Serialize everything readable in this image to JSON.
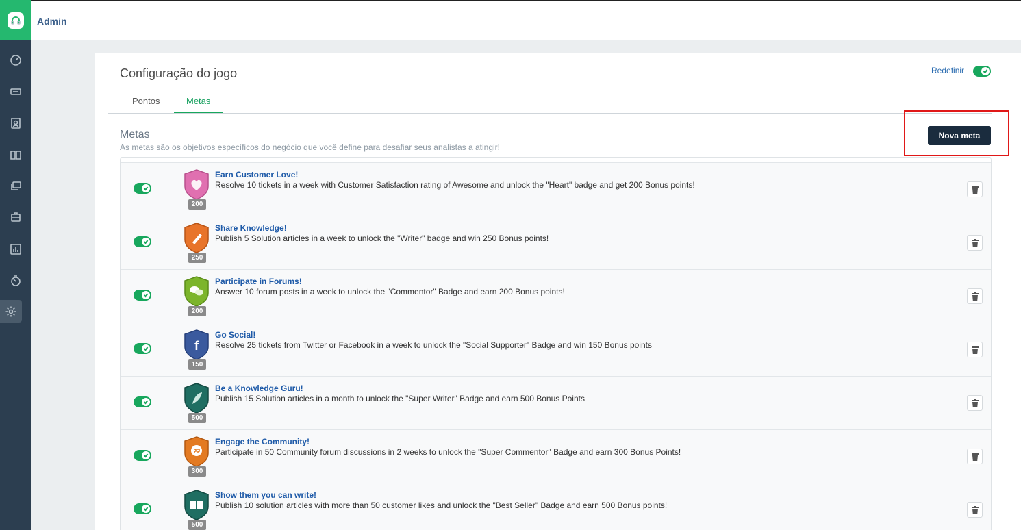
{
  "header": {
    "title": "Admin"
  },
  "sidebar": {
    "items": [
      {
        "icon": "dashboard-icon"
      },
      {
        "icon": "ticket-icon"
      },
      {
        "icon": "contacts-icon"
      },
      {
        "icon": "knowledge-base-icon"
      },
      {
        "icon": "forums-icon"
      },
      {
        "icon": "solutions-icon"
      },
      {
        "icon": "reports-icon"
      },
      {
        "icon": "timer-icon"
      },
      {
        "icon": "admin-gear-icon",
        "active": true
      }
    ]
  },
  "page": {
    "title": "Configuração do jogo",
    "reset_label": "Redefinir",
    "reset_enabled": true,
    "tabs": [
      {
        "label": "Pontos",
        "active": false
      },
      {
        "label": "Metas",
        "active": true
      }
    ],
    "section_title": "Metas",
    "section_desc": "As metas são os objetivos específicos do negócio que você define para desafiar seus analistas a atingir!",
    "new_goal_label": "Nova meta"
  },
  "goals": [
    {
      "name": "Earn Customer Love!",
      "desc": "Resolve 10 tickets in a week with Customer Satisfaction rating of Awesome and unlock the \"Heart\" badge and get 200 Bonus points!",
      "points": "200",
      "badge_color": "#e070b0",
      "badge_icon": "heart-badge-icon",
      "enabled": true
    },
    {
      "name": "Share Knowledge!",
      "desc": "Publish 5 Solution articles in a week to unlock the \"Writer\" badge and win 250 Bonus points!",
      "points": "250",
      "badge_color": "#e8742a",
      "badge_icon": "pen-badge-icon",
      "enabled": true
    },
    {
      "name": "Participate in Forums!",
      "desc": "Answer 10 forum posts in a week to unlock the \"Commentor\" Badge and earn 200 Bonus points!",
      "points": "200",
      "badge_color": "#7cb52b",
      "badge_icon": "chat-badge-icon",
      "enabled": true
    },
    {
      "name": "Go Social!",
      "desc": "Resolve 25 tickets from Twitter or Facebook in a week to unlock the \"Social Supporter\" Badge and win 150 Bonus points",
      "points": "150",
      "badge_color": "#3a5a9e",
      "badge_icon": "facebook-badge-icon",
      "enabled": true
    },
    {
      "name": "Be a Knowledge Guru!",
      "desc": "Publish 15 Solution articles in a month to unlock the \"Super Writer\" Badge and earn 500 Bonus Points",
      "points": "500",
      "badge_color": "#1f6e62",
      "badge_icon": "feather-badge-icon",
      "enabled": true
    },
    {
      "name": "Engage the Community!",
      "desc": "Participate in 50 Community forum discussions in 2 weeks to unlock the \"Super Commentor\" Badge and earn 300 Bonus Points!",
      "points": "300",
      "badge_color": "#e37a22",
      "badge_icon": "quote-badge-icon",
      "enabled": true
    },
    {
      "name": "Show them you can write!",
      "desc": "Publish 10 solution articles with more than 50 customer likes and unlock the \"Best Seller\" Badge and earn 500 Bonus points!",
      "points": "500",
      "badge_color": "#1f6e62",
      "badge_icon": "book-badge-icon",
      "enabled": true
    }
  ]
}
